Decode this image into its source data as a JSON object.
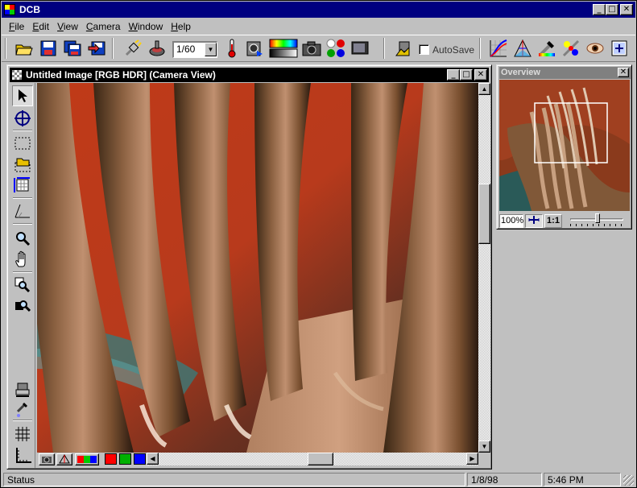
{
  "app": {
    "title": "DCB"
  },
  "window_controls": {
    "minimize": "_",
    "maximize": "□",
    "close": "✕"
  },
  "menu": [
    {
      "label": "File",
      "accel": "F",
      "rest": "ile"
    },
    {
      "label": "Edit",
      "accel": "E",
      "rest": "dit"
    },
    {
      "label": "View",
      "accel": "V",
      "rest": "iew"
    },
    {
      "label": "Camera",
      "accel": "C",
      "rest": "amera"
    },
    {
      "label": "Window",
      "accel": "W",
      "rest": "indow"
    },
    {
      "label": "Help",
      "accel": "H",
      "rest": "elp"
    }
  ],
  "toolbar": {
    "shutter_value": "1/60",
    "autosave_label": "AutoSave",
    "autosave_checked": false,
    "icons": {
      "open": "open-folder-icon",
      "save": "save-disk-icon",
      "save_all": "save-all-icon",
      "export": "export-icon",
      "connect": "connect-plug-icon",
      "capture": "capture-icon",
      "temperature": "thermometer-icon",
      "auto_expose": "auto-expose-icon",
      "color_gradient": "color-gradient-icon",
      "camera": "camera-icon",
      "rgb_channels": "rgb-channels-icon",
      "monitor": "monitor-icon",
      "autosave": "autosave-icon",
      "curves": "curves-icon",
      "histogram": "histogram-icon",
      "eyedropper": "eyedropper-icon",
      "calibrate": "calibrate-icon",
      "preview": "eye-icon",
      "zoom_fit": "zoom-fit-icon"
    }
  },
  "image_window": {
    "title": "Untitled Image [RGB HDR] (Camera View)"
  },
  "tools": [
    "arrow-tool",
    "target-tool",
    "marquee-tool",
    "load-selection-tool",
    "measure-tool",
    "angle-tool",
    "zoom-tool",
    "hand-tool",
    "zoom-region-tool",
    "zoom-out-tool",
    "stamp-tool",
    "eyedropper-tool",
    "grid-tool",
    "ruler-tool"
  ],
  "bottom_swatches": {
    "colors": [
      "#ff0000",
      "#00b000",
      "#0000ff"
    ]
  },
  "overview": {
    "title": "Overview",
    "zoom_value": "100%",
    "one_to_one_label": "1:1",
    "slider_value": 0.5
  },
  "status": {
    "text": "Status",
    "date": "1/8/98",
    "time": "5:46 PM"
  }
}
